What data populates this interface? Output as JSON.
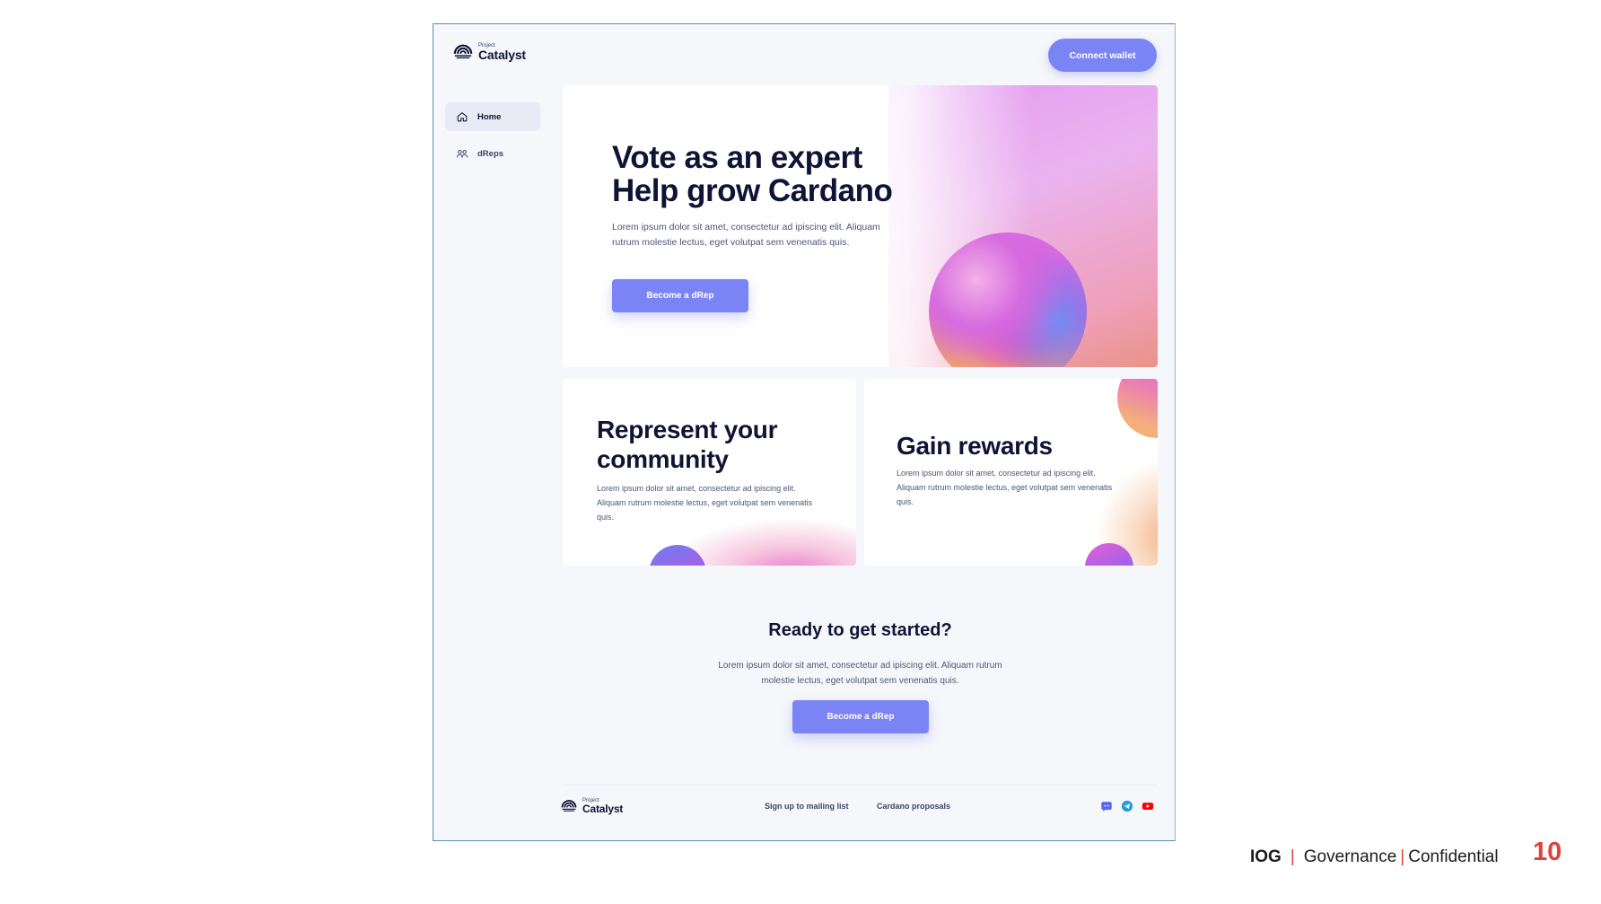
{
  "app": {
    "logo": {
      "small": "Project",
      "big": "Catalyst"
    },
    "connect_label": "Connect wallet"
  },
  "sidebar": {
    "items": [
      {
        "label": "Home",
        "icon": "home-icon",
        "active": true
      },
      {
        "label": "dReps",
        "icon": "people-icon",
        "active": false
      }
    ]
  },
  "hero": {
    "title_line1": "Vote as an expert",
    "title_line2": "Help grow Cardano",
    "description": "Lorem ipsum dolor sit amet, consectetur ad ipiscing elit. Aliquam rutrum molestie lectus, eget volutpat sem venenatis quis.",
    "button": "Become a dRep"
  },
  "cards": [
    {
      "title_line1": "Represent your",
      "title_line2": "community",
      "description": "Lorem ipsum dolor sit amet, consectetur ad ipiscing elit. Aliquam rutrum molestie lectus, eget volutpat sem venenatis quis."
    },
    {
      "title_line1": "Gain rewards",
      "description": "Lorem ipsum dolor sit amet, consectetur ad ipiscing elit. Aliquam rutrum molestie lectus, eget volutpat sem venenatis quis."
    }
  ],
  "cta": {
    "title": "Ready to get started?",
    "description": "Lorem ipsum dolor sit amet, consectetur ad ipiscing elit. Aliquam rutrum molestie lectus, eget volutpat sem venenatis quis.",
    "button": "Become a dRep"
  },
  "footer": {
    "logo": {
      "small": "Project",
      "big": "Catalyst"
    },
    "links": [
      "Sign up to mailing list",
      "Cardano proposals"
    ],
    "social": [
      "discord-icon",
      "telegram-icon",
      "youtube-icon"
    ]
  },
  "slide": {
    "brand": "IOG",
    "separator": "|",
    "section": "Governance",
    "label": "Confidential",
    "page_number": "10"
  },
  "colors": {
    "accent": "#7b84f4",
    "ink": "#0f1435",
    "slide_red": "#e0413a"
  }
}
